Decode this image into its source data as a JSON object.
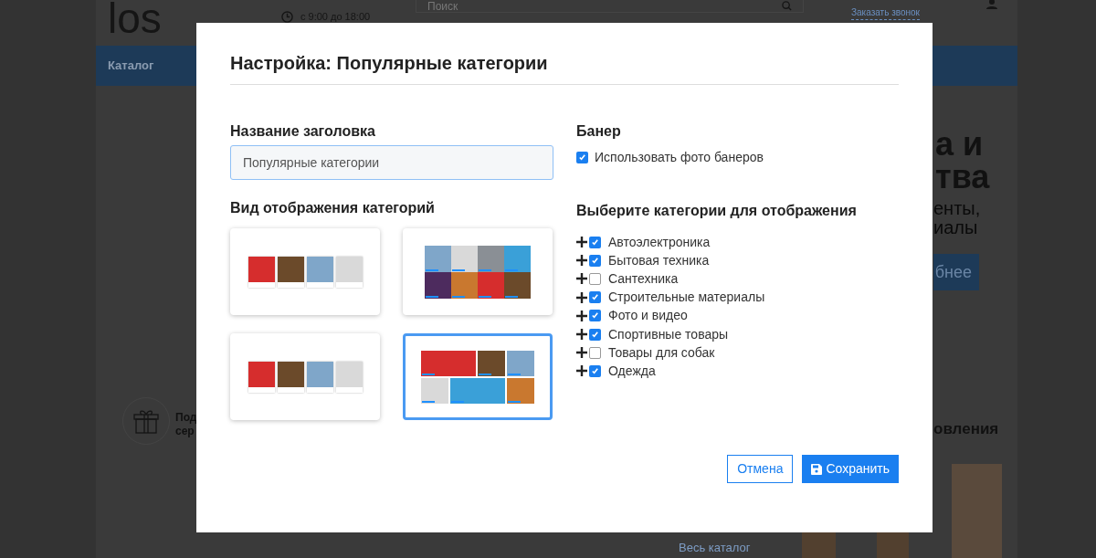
{
  "background": {
    "logo": "los",
    "hours": "с 9:00 до 18:00",
    "search": {
      "placeholder": "Поиск"
    },
    "callback_link": "Заказать звонок",
    "nav": {
      "catalog": "Каталог"
    },
    "hero": {
      "title_lines": [
        "а и",
        "тва"
      ],
      "subtitle_lines": [
        "енты,",
        "иалы"
      ],
      "button": "бнее"
    },
    "feature": {
      "lines": [
        "Под",
        "сер"
      ]
    },
    "section_title": "овления",
    "catalog_link": "Весь каталог"
  },
  "modal": {
    "title": "Настройка: Популярные категории",
    "heading_field": {
      "label": "Название заголовка",
      "value": "Популярные категории"
    },
    "layout": {
      "label": "Вид отображения категорий",
      "options": [
        {
          "kind": "strip",
          "selected": false
        },
        {
          "kind": "grid",
          "selected": false
        },
        {
          "kind": "strip",
          "selected": false
        },
        {
          "kind": "mosaic",
          "selected": true
        }
      ]
    },
    "banner": {
      "label": "Банер",
      "option": {
        "label": "Использовать фото банеров",
        "checked": true
      }
    },
    "categories": {
      "label": "Выберите категории для отображения",
      "items": [
        {
          "label": "Автоэлектроника",
          "checked": true
        },
        {
          "label": "Бытовая техника",
          "checked": true
        },
        {
          "label": "Сантехника",
          "checked": false
        },
        {
          "label": "Строительные материалы",
          "checked": true
        },
        {
          "label": "Фото и видео",
          "checked": true
        },
        {
          "label": "Спортивные товары",
          "checked": true
        },
        {
          "label": "Товары для собак",
          "checked": false
        },
        {
          "label": "Одежда",
          "checked": true
        }
      ]
    },
    "buttons": {
      "cancel": "Отмена",
      "save": "Сохранить"
    }
  }
}
